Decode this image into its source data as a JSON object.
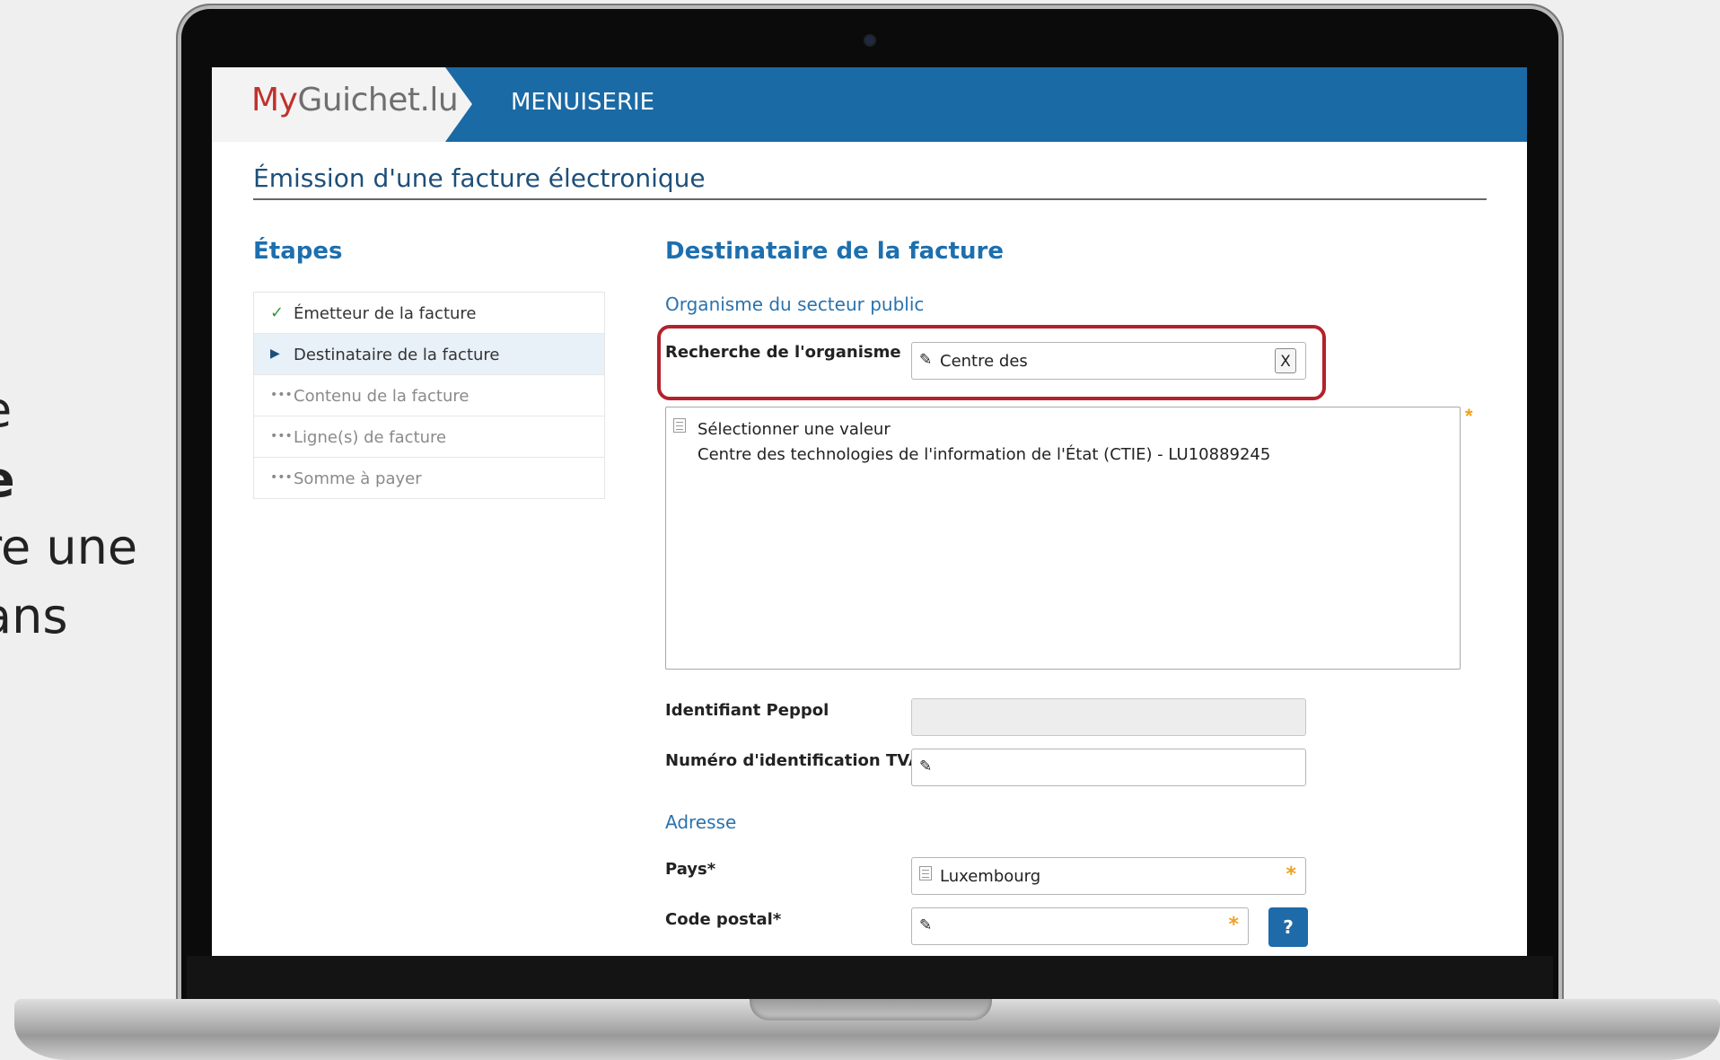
{
  "side_text": [
    "e",
    "e",
    "re une",
    "ans"
  ],
  "header": {
    "logo_my": "My",
    "logo_rest": "Guichet.lu",
    "app_name": "MENUISERIE"
  },
  "page": {
    "title": "Émission d'une facture électronique"
  },
  "steps": {
    "title": "Étapes",
    "items": [
      {
        "label": "Émetteur de la facture",
        "state": "done",
        "icon": "check-icon"
      },
      {
        "label": "Destinataire de la facture",
        "state": "active",
        "icon": "caret-right-icon"
      },
      {
        "label": "Contenu de la facture",
        "state": "pending",
        "icon": "ellipsis-icon"
      },
      {
        "label": "Ligne(s) de facture",
        "state": "pending",
        "icon": "ellipsis-icon"
      },
      {
        "label": "Somme à payer",
        "state": "pending",
        "icon": "ellipsis-icon"
      }
    ]
  },
  "form": {
    "section_title": "Destinataire de la facture",
    "sub_public": "Organisme du secteur public",
    "search_label": "Recherche de l'organisme",
    "search_value": "Centre des",
    "clear_label": "X",
    "list_placeholder": "Sélectionner une valeur",
    "list_option": "Centre des technologies de l'information de l'État (CTIE) - LU10889245",
    "peppol_label": "Identifiant Peppol",
    "peppol_value": "",
    "tva_label": "Numéro d'identification TVA",
    "tva_value": "",
    "address_sub": "Adresse",
    "country_label": "Pays*",
    "country_value": "Luxembourg",
    "postal_label": "Code postal*",
    "postal_value": "",
    "help_label": "?",
    "required_mark": "*"
  },
  "colors": {
    "brand_blue": "#1a6aa5",
    "logo_red": "#c0312b",
    "highlight_red": "#b3222a",
    "required_orange": "#f0a020"
  }
}
